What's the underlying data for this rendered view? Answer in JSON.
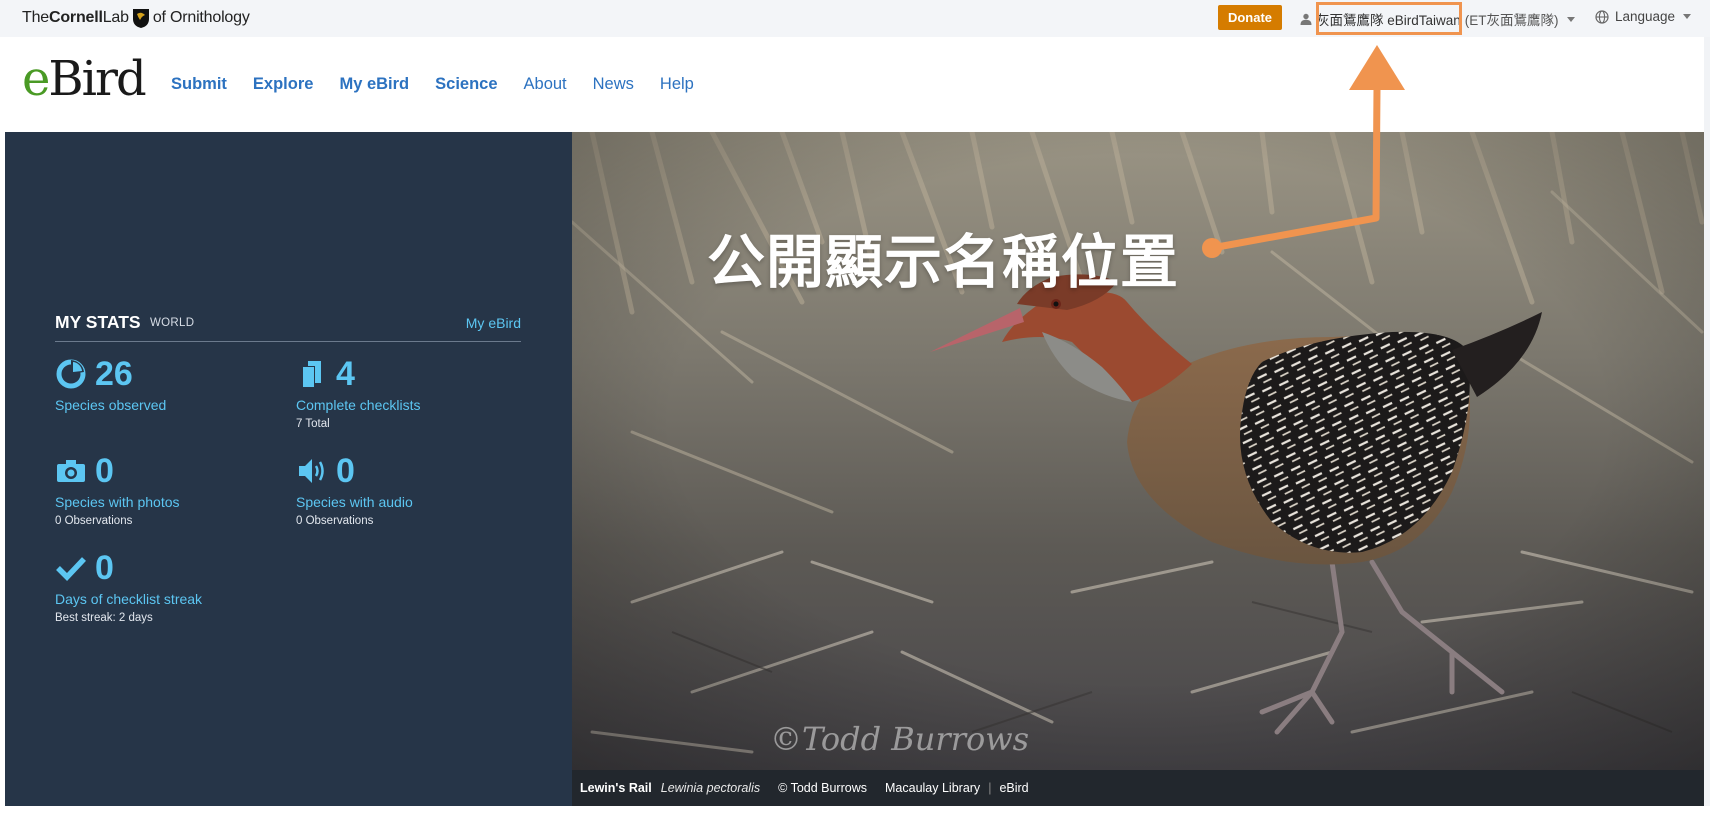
{
  "topbar": {
    "logo": {
      "the": "The",
      "cornell": "Cornell",
      "lab": "Lab",
      "of_ornithology": "of Ornithology"
    },
    "donate_label": "Donate",
    "user_display_name": "灰面鵟鷹隊 eBirdTaiwan",
    "user_alt_name": "(ET灰面鵟鷹隊)",
    "language_label": "Language"
  },
  "nav": {
    "logo": {
      "e": "e",
      "bird": "Bird"
    },
    "links": [
      {
        "label": "Submit"
      },
      {
        "label": "Explore"
      },
      {
        "label": "My eBird"
      },
      {
        "label": "Science"
      },
      {
        "label": "About"
      },
      {
        "label": "News"
      },
      {
        "label": "Help"
      }
    ]
  },
  "stats": {
    "title": "MY STATS",
    "scope": "WORLD",
    "link": "My eBird",
    "items": [
      {
        "icon": "species-pie-icon",
        "value": "26",
        "label": "Species observed",
        "sub": ""
      },
      {
        "icon": "checklist-icon",
        "value": "4",
        "label": "Complete checklists",
        "sub": "7 Total"
      },
      {
        "icon": "camera-icon",
        "value": "0",
        "label": "Species with photos",
        "sub": "0 Observations"
      },
      {
        "icon": "speaker-icon",
        "value": "0",
        "label": "Species with audio",
        "sub": "0 Observations"
      },
      {
        "icon": "checkmark-icon",
        "value": "0",
        "label": "Days of checklist streak",
        "sub": "Best streak: 2 days"
      }
    ]
  },
  "hero": {
    "annotation": "公開顯示名稱位置",
    "watermark": "©Todd Burrows",
    "caption": {
      "common_name": "Lewin's Rail",
      "scientific_name": "Lewinia pectoralis",
      "credit": "© Todd Burrows",
      "library": "Macaulay Library",
      "site": "eBird"
    }
  },
  "colors": {
    "panel": "#263548",
    "accent": "#5cc6f2",
    "nav_link": "#2c72c0",
    "donate": "#d57c00",
    "annotation": "#f0944f"
  }
}
